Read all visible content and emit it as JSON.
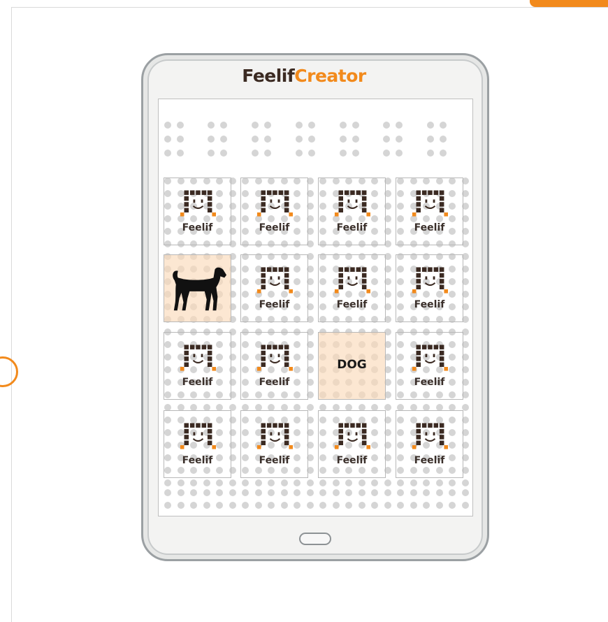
{
  "brand": {
    "part1": "Feelif",
    "part2": "Creator"
  },
  "colors": {
    "accent": "#f28a1c",
    "logo_dark": "#3b2a22",
    "highlight": "#fadaba",
    "dot": "#d5d5d5"
  },
  "grid": {
    "tiles": [
      {
        "kind": "logo",
        "label": "Feelif",
        "highlight": false
      },
      {
        "kind": "logo",
        "label": "Feelif",
        "highlight": false
      },
      {
        "kind": "logo",
        "label": "Feelif",
        "highlight": false
      },
      {
        "kind": "logo",
        "label": "Feelif",
        "highlight": false
      },
      {
        "kind": "image",
        "icon": "dog-icon",
        "highlight": true
      },
      {
        "kind": "logo",
        "label": "Feelif",
        "highlight": false
      },
      {
        "kind": "logo",
        "label": "Feelif",
        "highlight": false
      },
      {
        "kind": "logo",
        "label": "Feelif",
        "highlight": false
      },
      {
        "kind": "logo",
        "label": "Feelif",
        "highlight": false
      },
      {
        "kind": "logo",
        "label": "Feelif",
        "highlight": false
      },
      {
        "kind": "word",
        "label": "DOG",
        "highlight": true
      },
      {
        "kind": "logo",
        "label": "Feelif",
        "highlight": false
      },
      {
        "kind": "logo",
        "label": "Feelif",
        "highlight": false
      },
      {
        "kind": "logo",
        "label": "Feelif",
        "highlight": false
      },
      {
        "kind": "logo",
        "label": "Feelif",
        "highlight": false
      },
      {
        "kind": "logo",
        "label": "Feelif",
        "highlight": false
      }
    ]
  }
}
